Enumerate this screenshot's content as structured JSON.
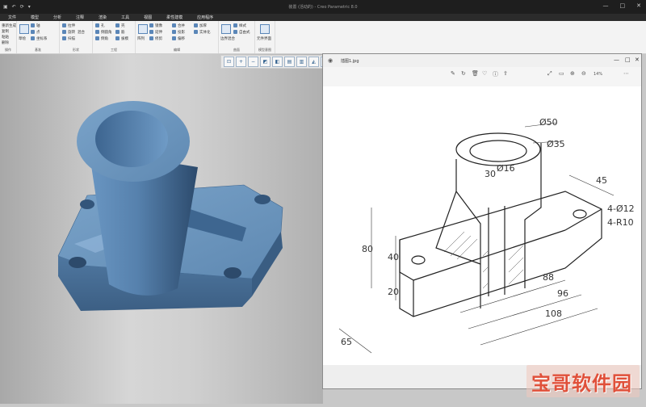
{
  "window": {
    "title": "装置 (活动的) - Creo Parametric 8.0",
    "quick_access": [
      "▣",
      "↶",
      "⟳",
      "▾"
    ],
    "controls": [
      "—",
      "□",
      "✕"
    ]
  },
  "menubar": [
    "文件",
    "模型",
    "分析",
    "注释",
    "渲染",
    "工具",
    "视图",
    "柔性建模",
    "应用程序"
  ],
  "ribbon": {
    "group1": {
      "items": [
        "重新生成",
        "复制",
        "粘贴",
        "删除"
      ],
      "label": "操作"
    },
    "group2": {
      "items": [
        "轴",
        "点",
        "坐标系",
        "草绘"
      ],
      "label": "基准"
    },
    "group3": {
      "items": [
        "拉伸",
        "旋转",
        "扫描",
        "混合"
      ],
      "label": "形状"
    },
    "group4": {
      "items": [
        "孔",
        "倒圆角",
        "倒角",
        "壳",
        "筋",
        "拔模"
      ],
      "label": "工程"
    },
    "group5": {
      "items": [
        "阵列",
        "镜像",
        "延伸",
        "修剪",
        "合并",
        "投影",
        "偏移",
        "加厚",
        "实体化"
      ],
      "label": "编辑"
    },
    "group6": {
      "items": [
        "边界混合",
        "样式",
        "自由式"
      ],
      "label": "曲面"
    },
    "group7": {
      "items": [
        "元件界面"
      ],
      "label": "模型意图"
    }
  },
  "viewer": {
    "filename": "插图1.jpg",
    "zoom": "14%"
  },
  "drawing": {
    "dims": [
      "Ø50",
      "Ø35",
      "30",
      "Ø16",
      "45",
      "4-Ø12",
      "4-R10",
      "80",
      "40",
      "20",
      "88",
      "96",
      "108",
      "65"
    ]
  },
  "watermark": "宝哥软件园"
}
